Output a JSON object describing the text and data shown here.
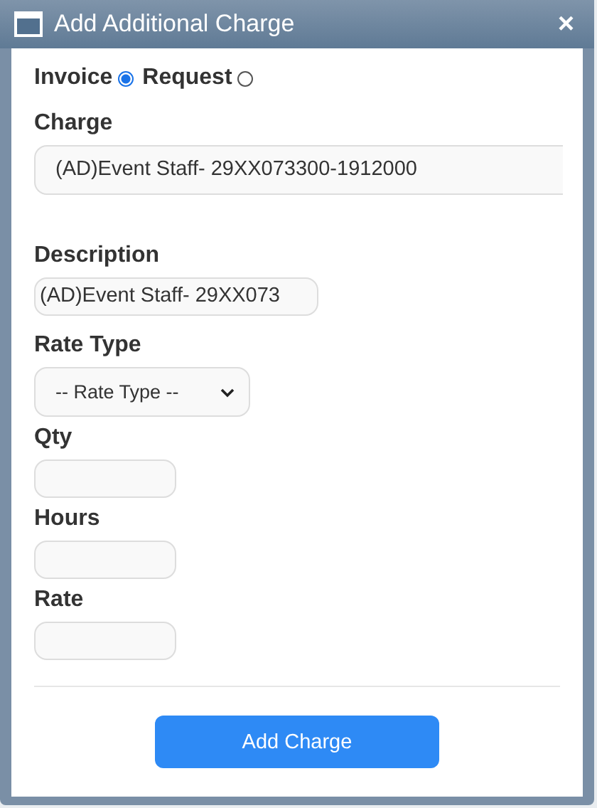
{
  "window": {
    "title": "Add Additional Charge",
    "close": "×"
  },
  "options": [
    {
      "label": "Invoice",
      "selected": true
    },
    {
      "label": "Request",
      "selected": false
    }
  ],
  "fields": [
    {
      "kind": "wide",
      "label": "Charge",
      "value": "(AD)Event Staff- 29XX073300-1912000"
    },
    {
      "kind": "text",
      "label": "Description",
      "value": "(AD)Event Staff- 29XX073"
    },
    {
      "kind": "select",
      "label": "Rate Type",
      "value": "-- Rate Type --"
    },
    {
      "kind": "small",
      "label": "Qty"
    },
    {
      "kind": "small",
      "label": "Hours"
    },
    {
      "kind": "small",
      "label": "Rate"
    }
  ],
  "button": "Add Charge"
}
